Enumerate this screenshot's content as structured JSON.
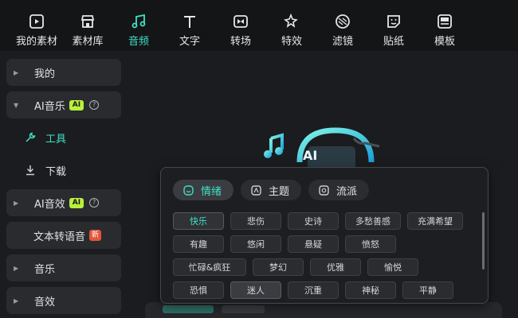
{
  "toolbar": {
    "items": [
      {
        "label": "我的素材",
        "icon": "my-materials-icon"
      },
      {
        "label": "素材库",
        "icon": "store-icon"
      },
      {
        "label": "音频",
        "icon": "music-note-icon"
      },
      {
        "label": "文字",
        "icon": "text-icon"
      },
      {
        "label": "转场",
        "icon": "transition-icon"
      },
      {
        "label": "特效",
        "icon": "effects-icon"
      },
      {
        "label": "滤镜",
        "icon": "filter-icon"
      },
      {
        "label": "贴纸",
        "icon": "sticker-icon"
      },
      {
        "label": "模板",
        "icon": "template-icon"
      }
    ],
    "active": "音频",
    "accent_color": "#3fe0c5"
  },
  "sidebar": {
    "items": [
      {
        "label": "我的",
        "expander": "collapsed"
      },
      {
        "label": "AI音乐",
        "badge": "AI",
        "expander": "expanded"
      },
      {
        "label": "工具",
        "icon": "wrench-icon",
        "selected": true
      },
      {
        "label": "下载",
        "icon": "download-icon"
      },
      {
        "label": "AI音效",
        "badge": "AI",
        "expander": "collapsed"
      },
      {
        "label": "文本转语音",
        "badge": "新"
      },
      {
        "label": "音乐",
        "expander": "collapsed"
      },
      {
        "label": "音效",
        "expander": "collapsed"
      }
    ]
  },
  "popover": {
    "tabs": [
      {
        "label": "情绪",
        "icon": "emotion-icon"
      },
      {
        "label": "主题",
        "icon": "theme-icon"
      },
      {
        "label": "流派",
        "icon": "genre-icon"
      }
    ],
    "active_tab": "情绪",
    "tags": [
      [
        "快乐",
        "悲伤",
        "史诗",
        "多愁善感",
        "充满希望"
      ],
      [
        "有趣",
        "悠闲",
        "悬疑",
        "愤怒"
      ],
      [
        "忙碌&疯狂",
        "梦幻",
        "优雅",
        "愉悦"
      ],
      [
        "恐惧",
        "迷人",
        "沉重",
        "神秘",
        "平静"
      ]
    ],
    "selected_tag": "快乐"
  },
  "hero": {
    "text": "AI"
  }
}
